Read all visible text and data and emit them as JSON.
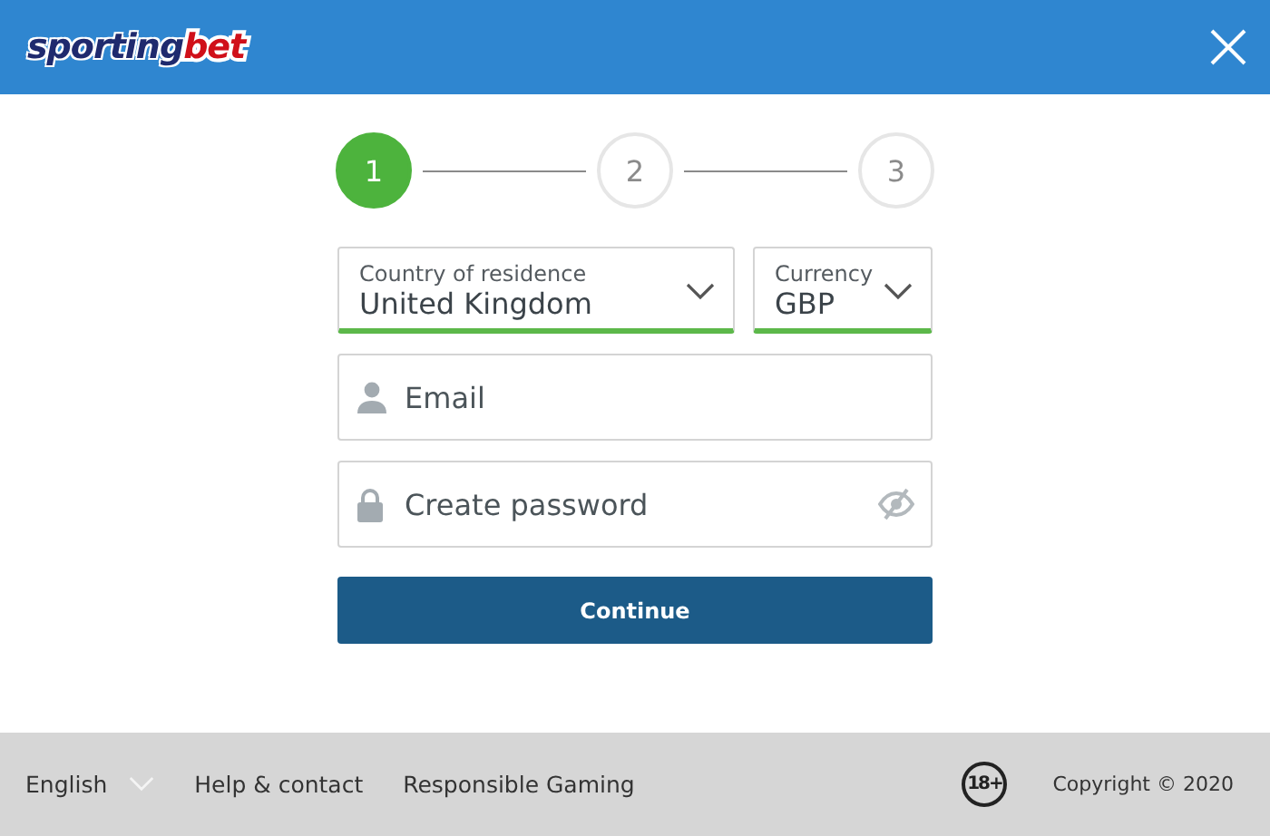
{
  "header": {
    "logo": {
      "primary": "sporting",
      "accent": "bet"
    }
  },
  "steps": [
    {
      "label": "1",
      "selected": true
    },
    {
      "label": "2",
      "selected": false
    },
    {
      "label": "3",
      "selected": false
    }
  ],
  "form": {
    "country": {
      "label": "Country of residence",
      "value": "United Kingdom"
    },
    "currency": {
      "label": "Currency",
      "value": "GBP"
    },
    "email": {
      "placeholder": "Email"
    },
    "password": {
      "placeholder": "Create password"
    },
    "submit": "Continue"
  },
  "footer": {
    "language": "English",
    "links": [
      "Help & contact",
      "Responsible Gaming"
    ],
    "age_badge": "18+",
    "copyright": "Copyright © 2020"
  }
}
